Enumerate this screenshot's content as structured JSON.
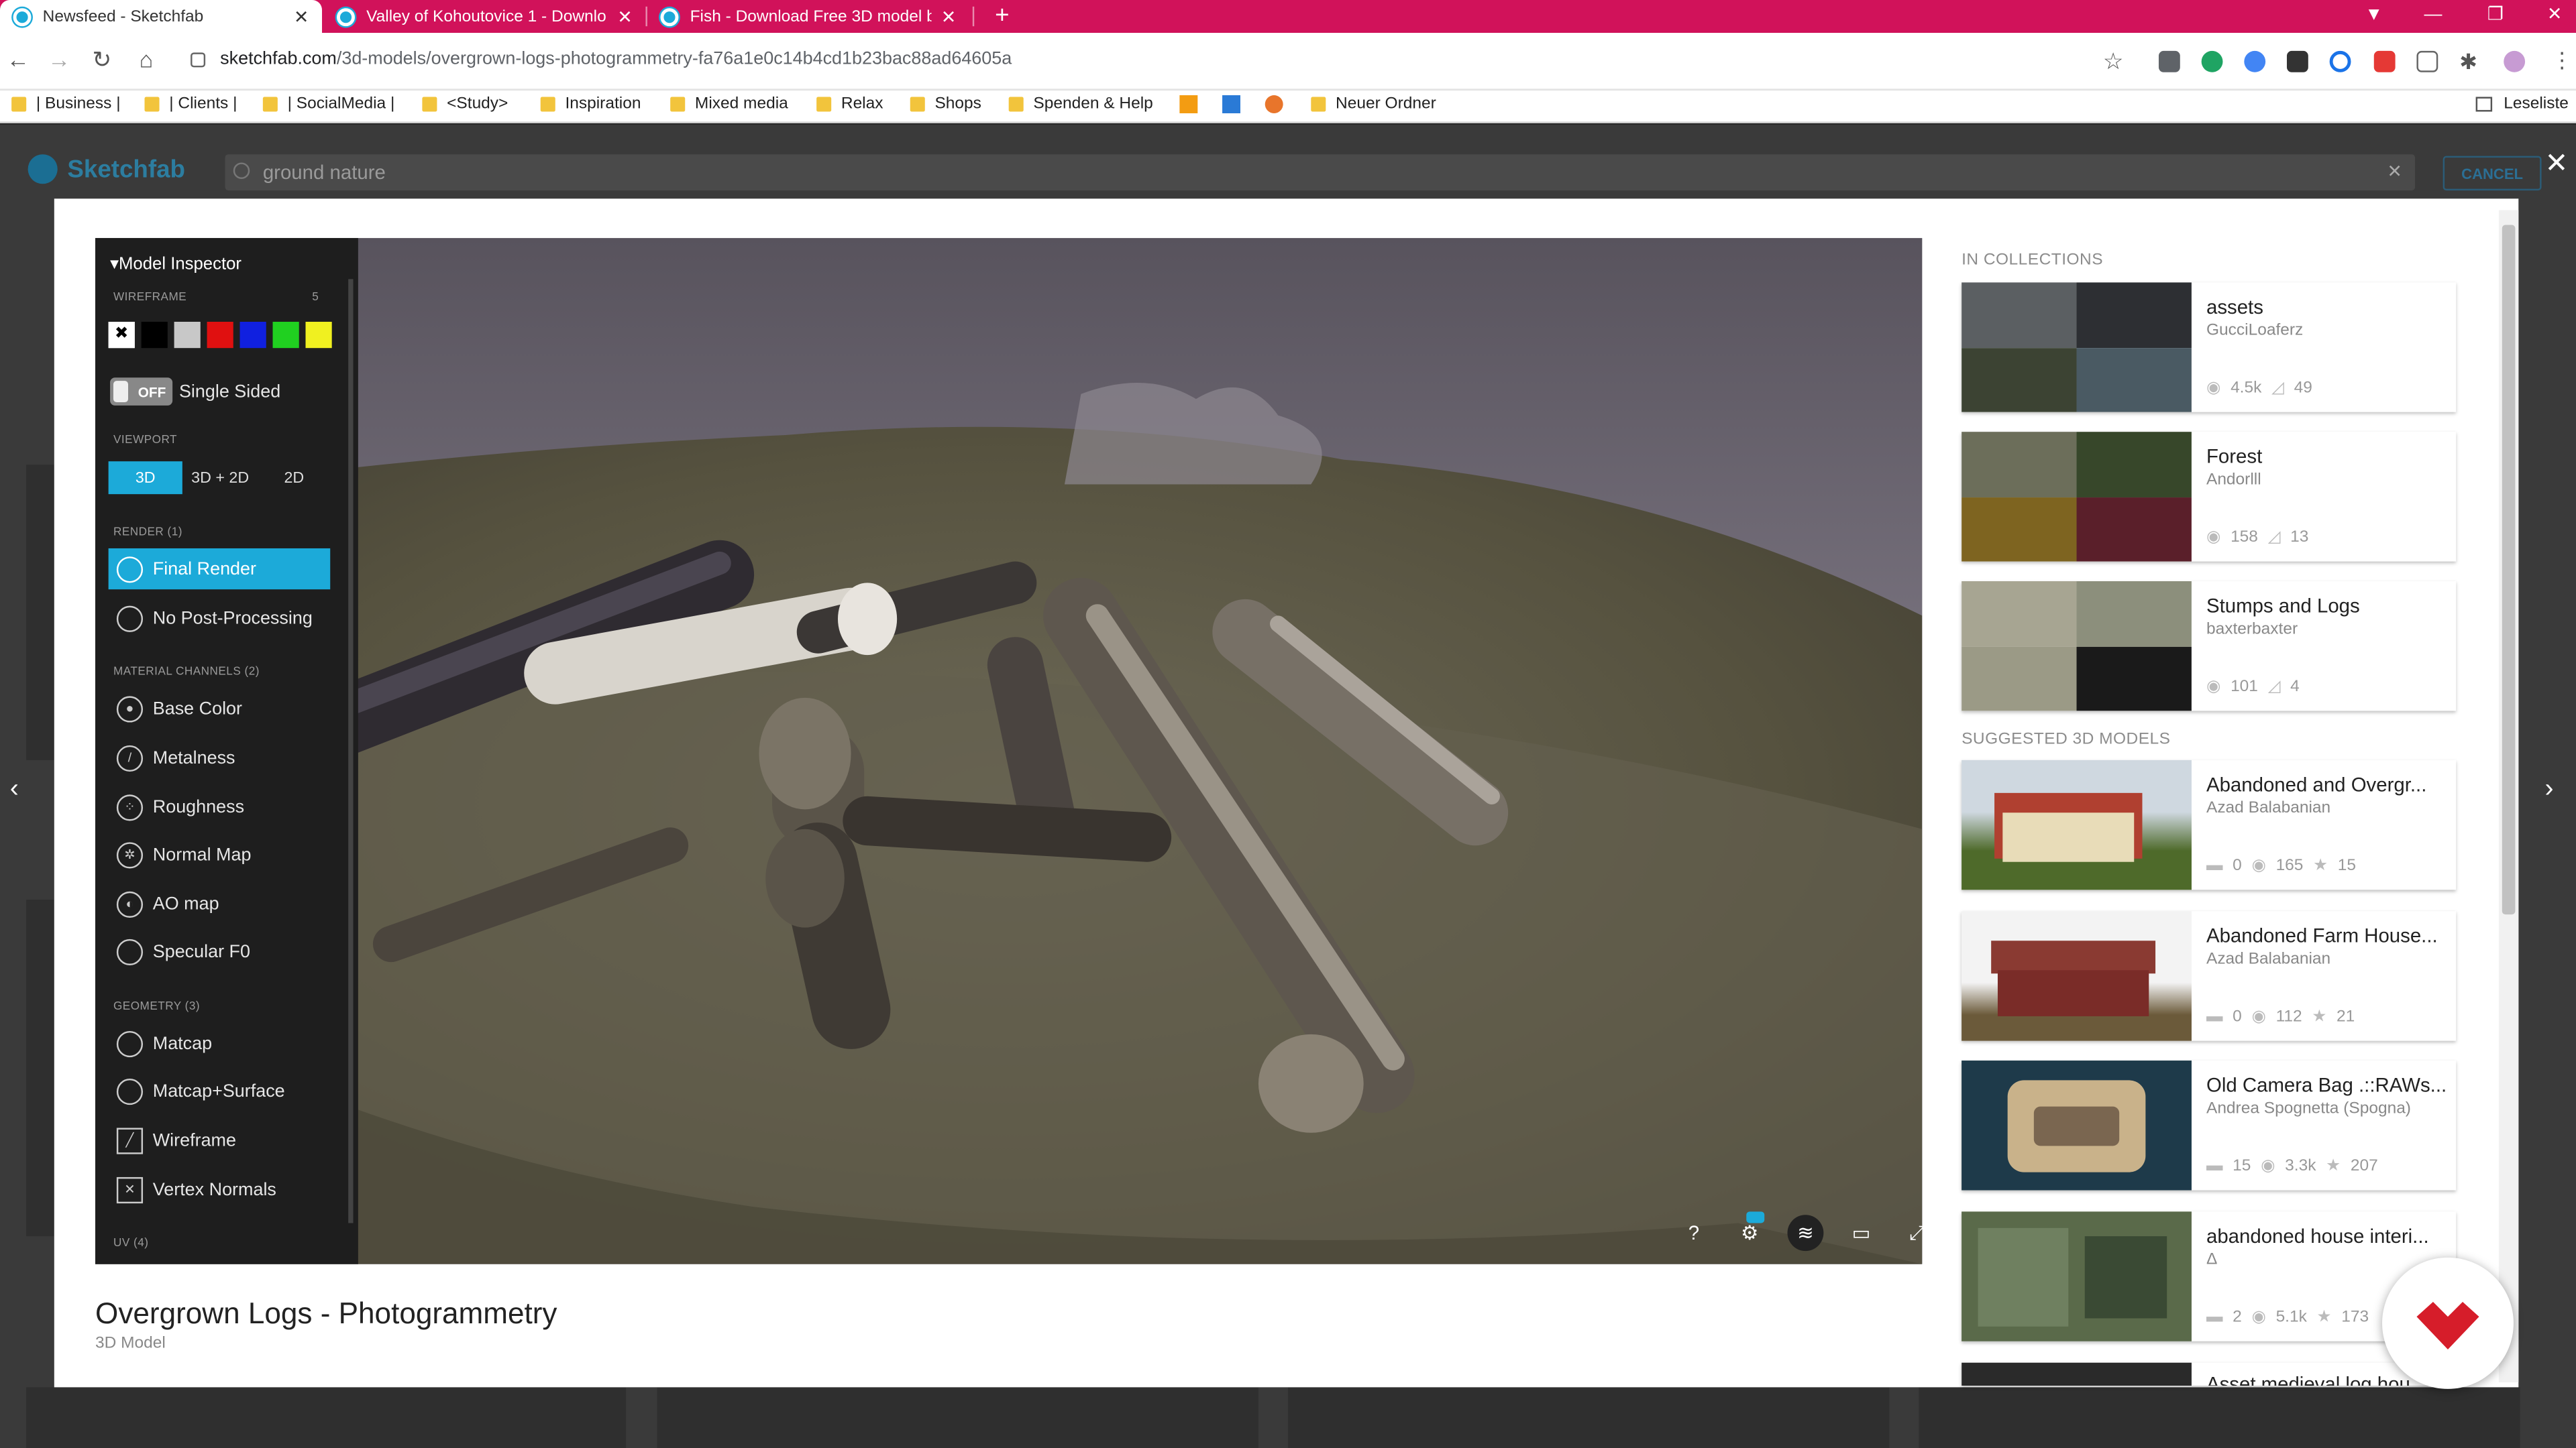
{
  "browser": {
    "tabs": [
      {
        "title": "Newsfeed - Sketchfab",
        "active": true
      },
      {
        "title": "Valley of Kohoutovice 1 - Downlo",
        "active": false
      },
      {
        "title": "Fish - Download Free 3D model b",
        "active": false
      }
    ],
    "url_domain": "sketchfab.com",
    "url_path": "/3d-models/overgrown-logs-photogrammetry-fa76a1e0c14b4cd1b23bac88ad64605a",
    "bookmarks": [
      "| Business |",
      "| Clients |",
      "| SocialMedia |",
      "<Study>",
      "Inspiration",
      "Mixed media",
      "Relax",
      "Shops",
      "Spenden & Help",
      "Neuer Ordner"
    ],
    "reading_list": "Leseliste",
    "accent": "#d1125a"
  },
  "site": {
    "logo": "Sketchfab",
    "search_value": "ground nature",
    "cancel_label": "CANCEL"
  },
  "inspector": {
    "title": "Model Inspector",
    "wireframe_label": "WIREFRAME",
    "wireframe_count": "5",
    "swatches": [
      "#ffffff",
      "#000000",
      "#c8c8c8",
      "#e01010",
      "#1020e0",
      "#20d020",
      "#f0f020"
    ],
    "single_sided_toggle": "OFF",
    "single_sided_label": "Single Sided",
    "viewport_label": "VIEWPORT",
    "viewport_options": [
      "3D",
      "3D + 2D",
      "2D"
    ],
    "render_label": "RENDER (1)",
    "render_items": [
      "Final Render",
      "No Post-Processing"
    ],
    "material_label": "MATERIAL CHANNELS (2)",
    "material_items": [
      "Base Color",
      "Metalness",
      "Roughness",
      "Normal Map",
      "AO map",
      "Specular F0"
    ],
    "geometry_label": "GEOMETRY (3)",
    "geometry_items": [
      "Matcap",
      "Matcap+Surface",
      "Wireframe",
      "Vertex Normals"
    ],
    "uv_label": "UV (4)"
  },
  "viewer_controls": [
    "help-icon",
    "settings-icon",
    "layers-icon",
    "vr-icon",
    "fullscreen-icon"
  ],
  "model": {
    "title": "Overgrown Logs - Photogrammetry",
    "subtitle": "3D Model"
  },
  "collections": {
    "header": "IN COLLECTIONS",
    "items": [
      {
        "name": "assets",
        "user": "GucciLoaferz",
        "views": "4.5k",
        "models": "49"
      },
      {
        "name": "Forest",
        "user": "Andorlll",
        "views": "158",
        "models": "13"
      },
      {
        "name": "Stumps and Logs",
        "user": "baxterbaxter",
        "views": "101",
        "models": "4"
      }
    ]
  },
  "suggested": {
    "header": "SUGGESTED 3D MODELS",
    "items": [
      {
        "name": "Abandoned and Overgr...",
        "user": "Azad Balabanian",
        "comments": "0",
        "views": "165",
        "likes": "15"
      },
      {
        "name": "Abandoned Farm House...",
        "user": "Azad Balabanian",
        "comments": "0",
        "views": "112",
        "likes": "21"
      },
      {
        "name": "Old Camera Bag .::RAWs...",
        "user": "Andrea Spognetta (Spogna)",
        "comments": "15",
        "views": "3.3k",
        "likes": "207"
      },
      {
        "name": "abandoned house interi...",
        "user": "Δ",
        "comments": "2",
        "views": "5.1k",
        "likes": "173"
      },
      {
        "name": "Asset medieval log hou...",
        "user": "",
        "comments": "",
        "views": "",
        "likes": ""
      }
    ]
  }
}
